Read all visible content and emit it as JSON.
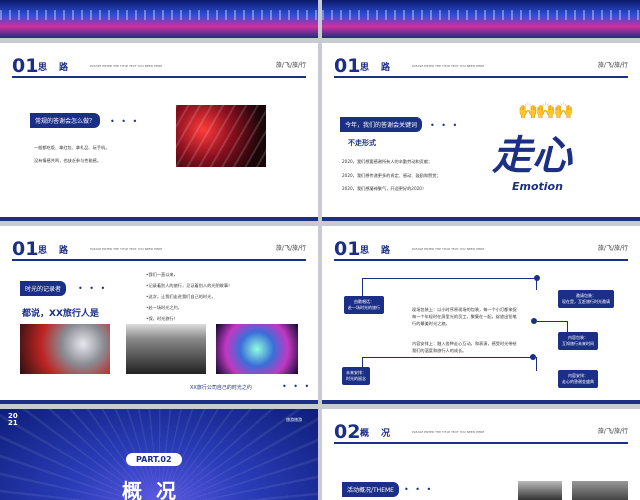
{
  "slides": {
    "header": {
      "num": "01",
      "title": "思路",
      "sub": "PLEASE ENTER THE TITLE TEXT YOU NEED HERE",
      "right": "旅/飞/旅/行"
    },
    "s3": {
      "tag": "常规的答谢会怎么做？",
      "items": [
        "一般都吃饭、拿红包、拿礼品、玩手机。",
        "没有情感共鸣，也缺乏参与性能感。"
      ]
    },
    "s4": {
      "tag": "今年，我们的答谢会关键词",
      "subtitle": "不走形式",
      "items": [
        "2020，我们想要感谢所有人的辛勤劳动和贡献；",
        "2020，我们想传递更多的肯定、感动、鼓励和赞赏；",
        "2020，我们想凝神聚气，开迎更好的2020！"
      ],
      "big": "走心",
      "emotion": "Emotion"
    },
    "s5": {
      "tag": "时光的记录者",
      "heading": "都说，XX旅行人是",
      "items": [
        "•我们一直以来，",
        "•记录着别人的旅行，见证着别人的光阴故事！",
        "•这次，让我们走进我们自己的时光，",
        "•赴一场时光之约，",
        "•保，时光旅行！"
      ],
      "caption": "XX旅行公司自己的时光之约"
    },
    "s6": {
      "n1": "由歌唱话：\n赴一场时光的旅行",
      "n2": "邀请包装：\n现在是，互赶旅行时光邀请",
      "mid1": "现场包装上：以小时序原现场的包装，每一个小灯都来捉\n每一个年轻时在屏里光的员工，聚集在一起，绽放出铅笔\n行的最美时光之旅。",
      "n3": "内容包装：\n互知旅行未来时间",
      "mid2": "内容安排上：融入各种走心互动，和表演，感受时光带给\n我们的温度和旅行人的成长。",
      "n4": "未来安排：\n时光的留念",
      "n5": "内容安排：\n走心的答谢金盛典"
    },
    "s7": {
      "year": "2021",
      "part": "PART.02",
      "title": "概况",
      "logo": "旅游旅游"
    },
    "s8": {
      "num": "02",
      "title": "概况",
      "sub": "PLEASE ENTER THE TITLE TEXT YOU NEED HERE",
      "right": "旅/飞/旅/行",
      "tag": "活动概况/THEME"
    }
  }
}
